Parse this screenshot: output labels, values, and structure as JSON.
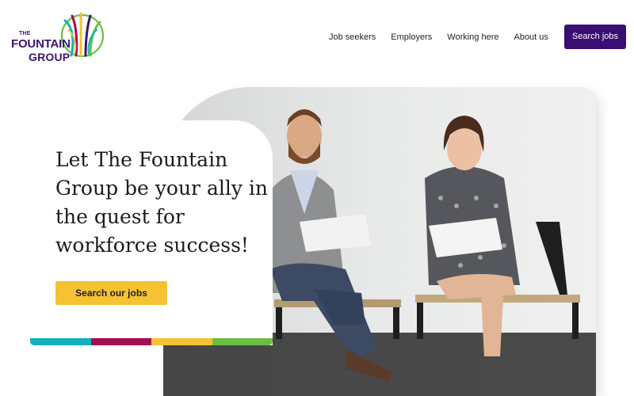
{
  "brand": {
    "line1": "THE",
    "line2": "FOUNTAIN",
    "line3": "GROUP",
    "logo_icon": "fountain-logo-icon",
    "colors": {
      "purple": "#3b1470",
      "green": "#6cbe45",
      "teal": "#12b2b8",
      "magenta": "#a50d51",
      "yellow": "#f5c232"
    }
  },
  "nav": {
    "items": [
      {
        "label": "Job seekers"
      },
      {
        "label": "Employers"
      },
      {
        "label": "Working here"
      },
      {
        "label": "About us"
      }
    ],
    "cta_label": "Search jobs",
    "cta_color": "#3a0e72"
  },
  "hero": {
    "headline": "Let The Fountain Group be your ally in the quest for workforce success!",
    "cta_label": "Search our jobs",
    "cta_color": "#f5c232",
    "stripe_colors": [
      "#12b2b8",
      "#a50d51",
      "#f5c232",
      "#6cbe45"
    ],
    "photo_description_icon": "two-people-seated-photo"
  }
}
